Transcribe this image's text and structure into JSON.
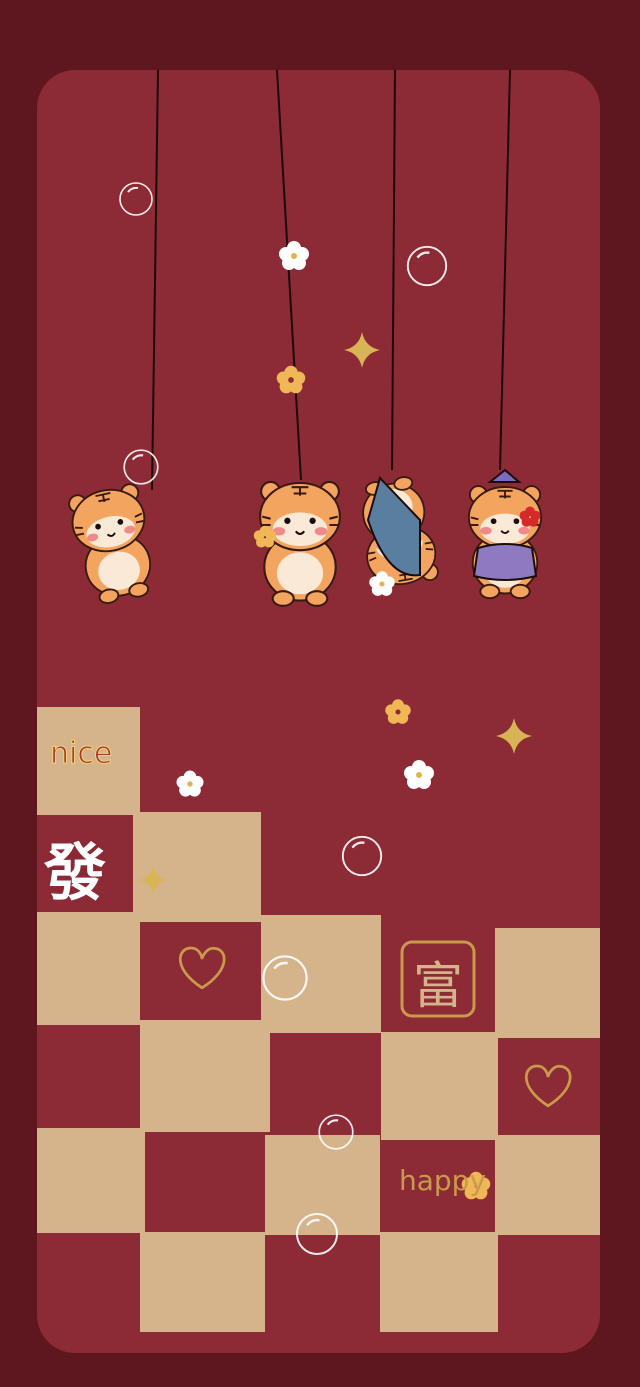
{
  "wallpaper": {
    "colors": {
      "outer": "#5e161f",
      "card": "#8c2a36",
      "tile": "#d5b38b",
      "tiger_orange": "#f3a560",
      "gold": "#e2b24f",
      "flower_white": "#ffffff",
      "line": "#1d0a0a"
    },
    "labels": {
      "nice": "nice",
      "fa": "發",
      "fu": "富",
      "happy": "happy"
    },
    "decorations": [
      "string",
      "tiger",
      "flower",
      "sparkle",
      "bubble",
      "heart"
    ]
  }
}
